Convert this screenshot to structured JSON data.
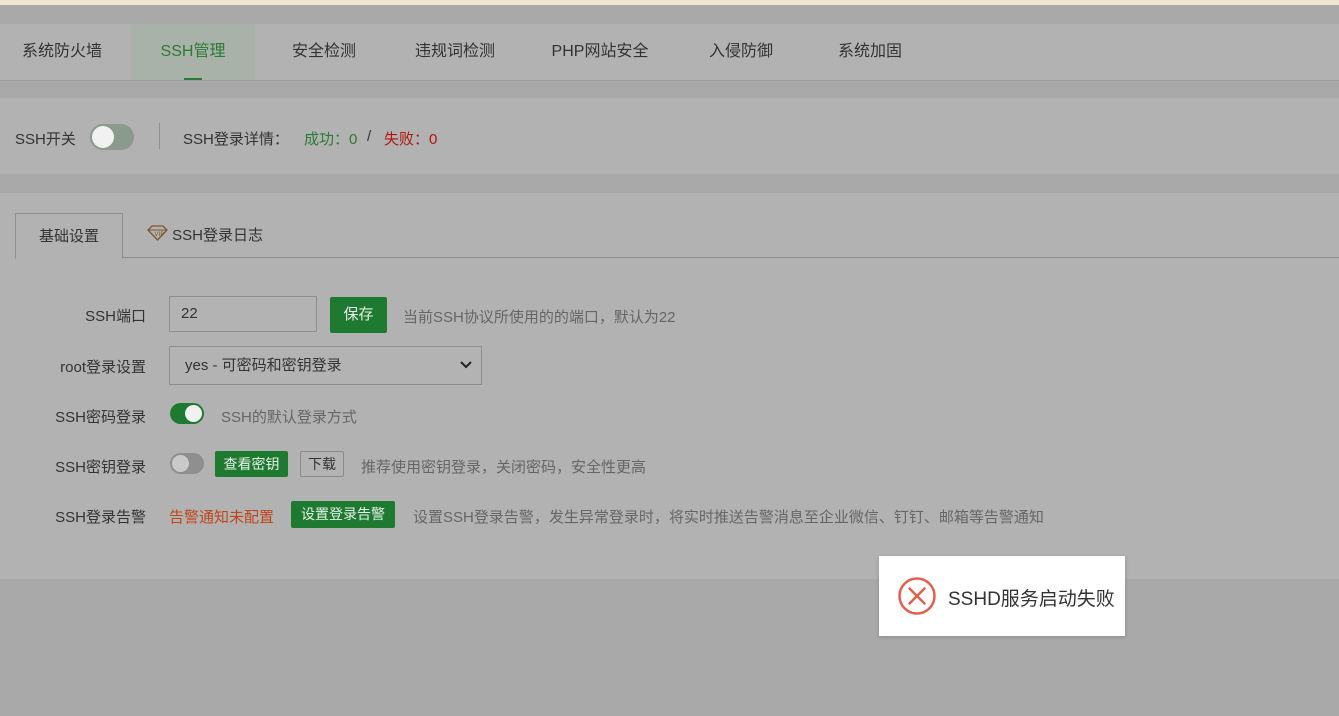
{
  "colors": {
    "accent_green": "#1f7a31",
    "success_text": "#2b7a35",
    "fail_text": "#b3140d",
    "warn_text": "#c0451a",
    "error_icon": "#e0604f"
  },
  "topnav": {
    "tabs": [
      {
        "label": "系统防火墙",
        "active": false
      },
      {
        "label": "SSH管理",
        "active": true
      },
      {
        "label": "安全检测",
        "active": false
      },
      {
        "label": "违规词检测",
        "active": false
      },
      {
        "label": "PHP网站安全",
        "active": false
      },
      {
        "label": "入侵防御",
        "active": false
      },
      {
        "label": "系统加固",
        "active": false
      }
    ]
  },
  "status": {
    "switch_label": "SSH开关",
    "switch_on": false,
    "detail_label": "SSH登录详情：",
    "success_text": "成功：0",
    "separator": "/",
    "fail_text": "失败：0"
  },
  "subtabs": {
    "basic": "基础设置",
    "log": "SSH登录日志",
    "log_icon": "diamond-vip-icon"
  },
  "form": {
    "port_label": "SSH端口",
    "port_value": "22",
    "save_button": "保存",
    "port_hint": "当前SSH协议所使用的的端口，默认为22",
    "root_label": "root登录设置",
    "root_value": "yes - 可密码和密钥登录",
    "password_label": "SSH密码登录",
    "password_on": true,
    "password_hint": "SSH的默认登录方式",
    "key_label": "SSH密钥登录",
    "key_on": false,
    "view_key_button": "查看密钥",
    "download_button": "下载",
    "key_hint": "推荐使用密钥登录，关闭密码，安全性更高",
    "alarm_label": "SSH登录告警",
    "alarm_status": "告警通知未配置",
    "alarm_button": "设置登录告警",
    "alarm_hint": "设置SSH登录告警，发生异常登录时，将实时推送告警消息至企业微信、钉钉、邮箱等告警通知"
  },
  "toast": {
    "icon": "error-circle-icon",
    "message": "SSHD服务启动失败"
  }
}
